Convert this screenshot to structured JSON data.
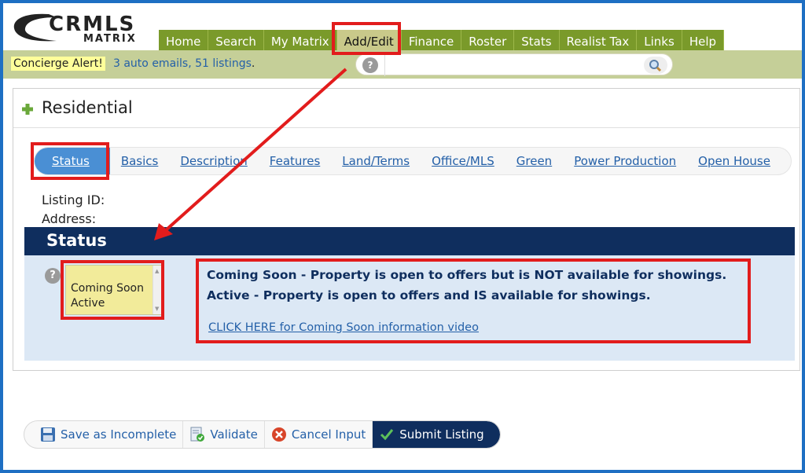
{
  "logo": {
    "top": "CRMLS",
    "bottom": "MATRIX"
  },
  "nav": {
    "items": [
      "Home",
      "Search",
      "My Matrix",
      "Add/Edit",
      "Finance",
      "Roster",
      "Stats",
      "Realist Tax",
      "Links",
      "Help"
    ],
    "active": "Add/Edit"
  },
  "alert": {
    "label": "Concierge Alert!",
    "link_text": "3 auto emails, 51 listings",
    "suffix": "."
  },
  "search": {
    "help_symbol": "?",
    "value": ""
  },
  "panel": {
    "title": "Residential",
    "tabs": [
      "Status",
      "Basics",
      "Description",
      "Features",
      "Land/Terms",
      "Office/MLS",
      "Green",
      "Power Production",
      "Open House"
    ],
    "active_tab": "Status",
    "listing_id_label": "Listing ID:",
    "address_label": "Address:"
  },
  "status_section": {
    "title": "Status",
    "help_symbol": "?",
    "options": [
      "Coming Soon",
      "Active"
    ],
    "info_line_1": "Coming Soon - Property is open to offers but is NOT available for showings.",
    "info_line_2": "Active - Property is open to offers and IS available for showings.",
    "video_link": "CLICK HERE for Coming Soon information video"
  },
  "actions": {
    "save_incomplete": "Save as Incomplete",
    "validate": "Validate",
    "cancel": "Cancel Input",
    "submit": "Submit Listing"
  },
  "colors": {
    "nav_green": "#7a9a2a",
    "nav_active": "#c9c98a",
    "alert_bar": "#c5cf98",
    "status_navy": "#0f2e5e",
    "status_body": "#dce8f5",
    "tab_active": "#4a8fd4",
    "annotation_red": "#e21c1c",
    "link_blue": "#2460a8",
    "select_yellow": "#f2eb9a"
  }
}
